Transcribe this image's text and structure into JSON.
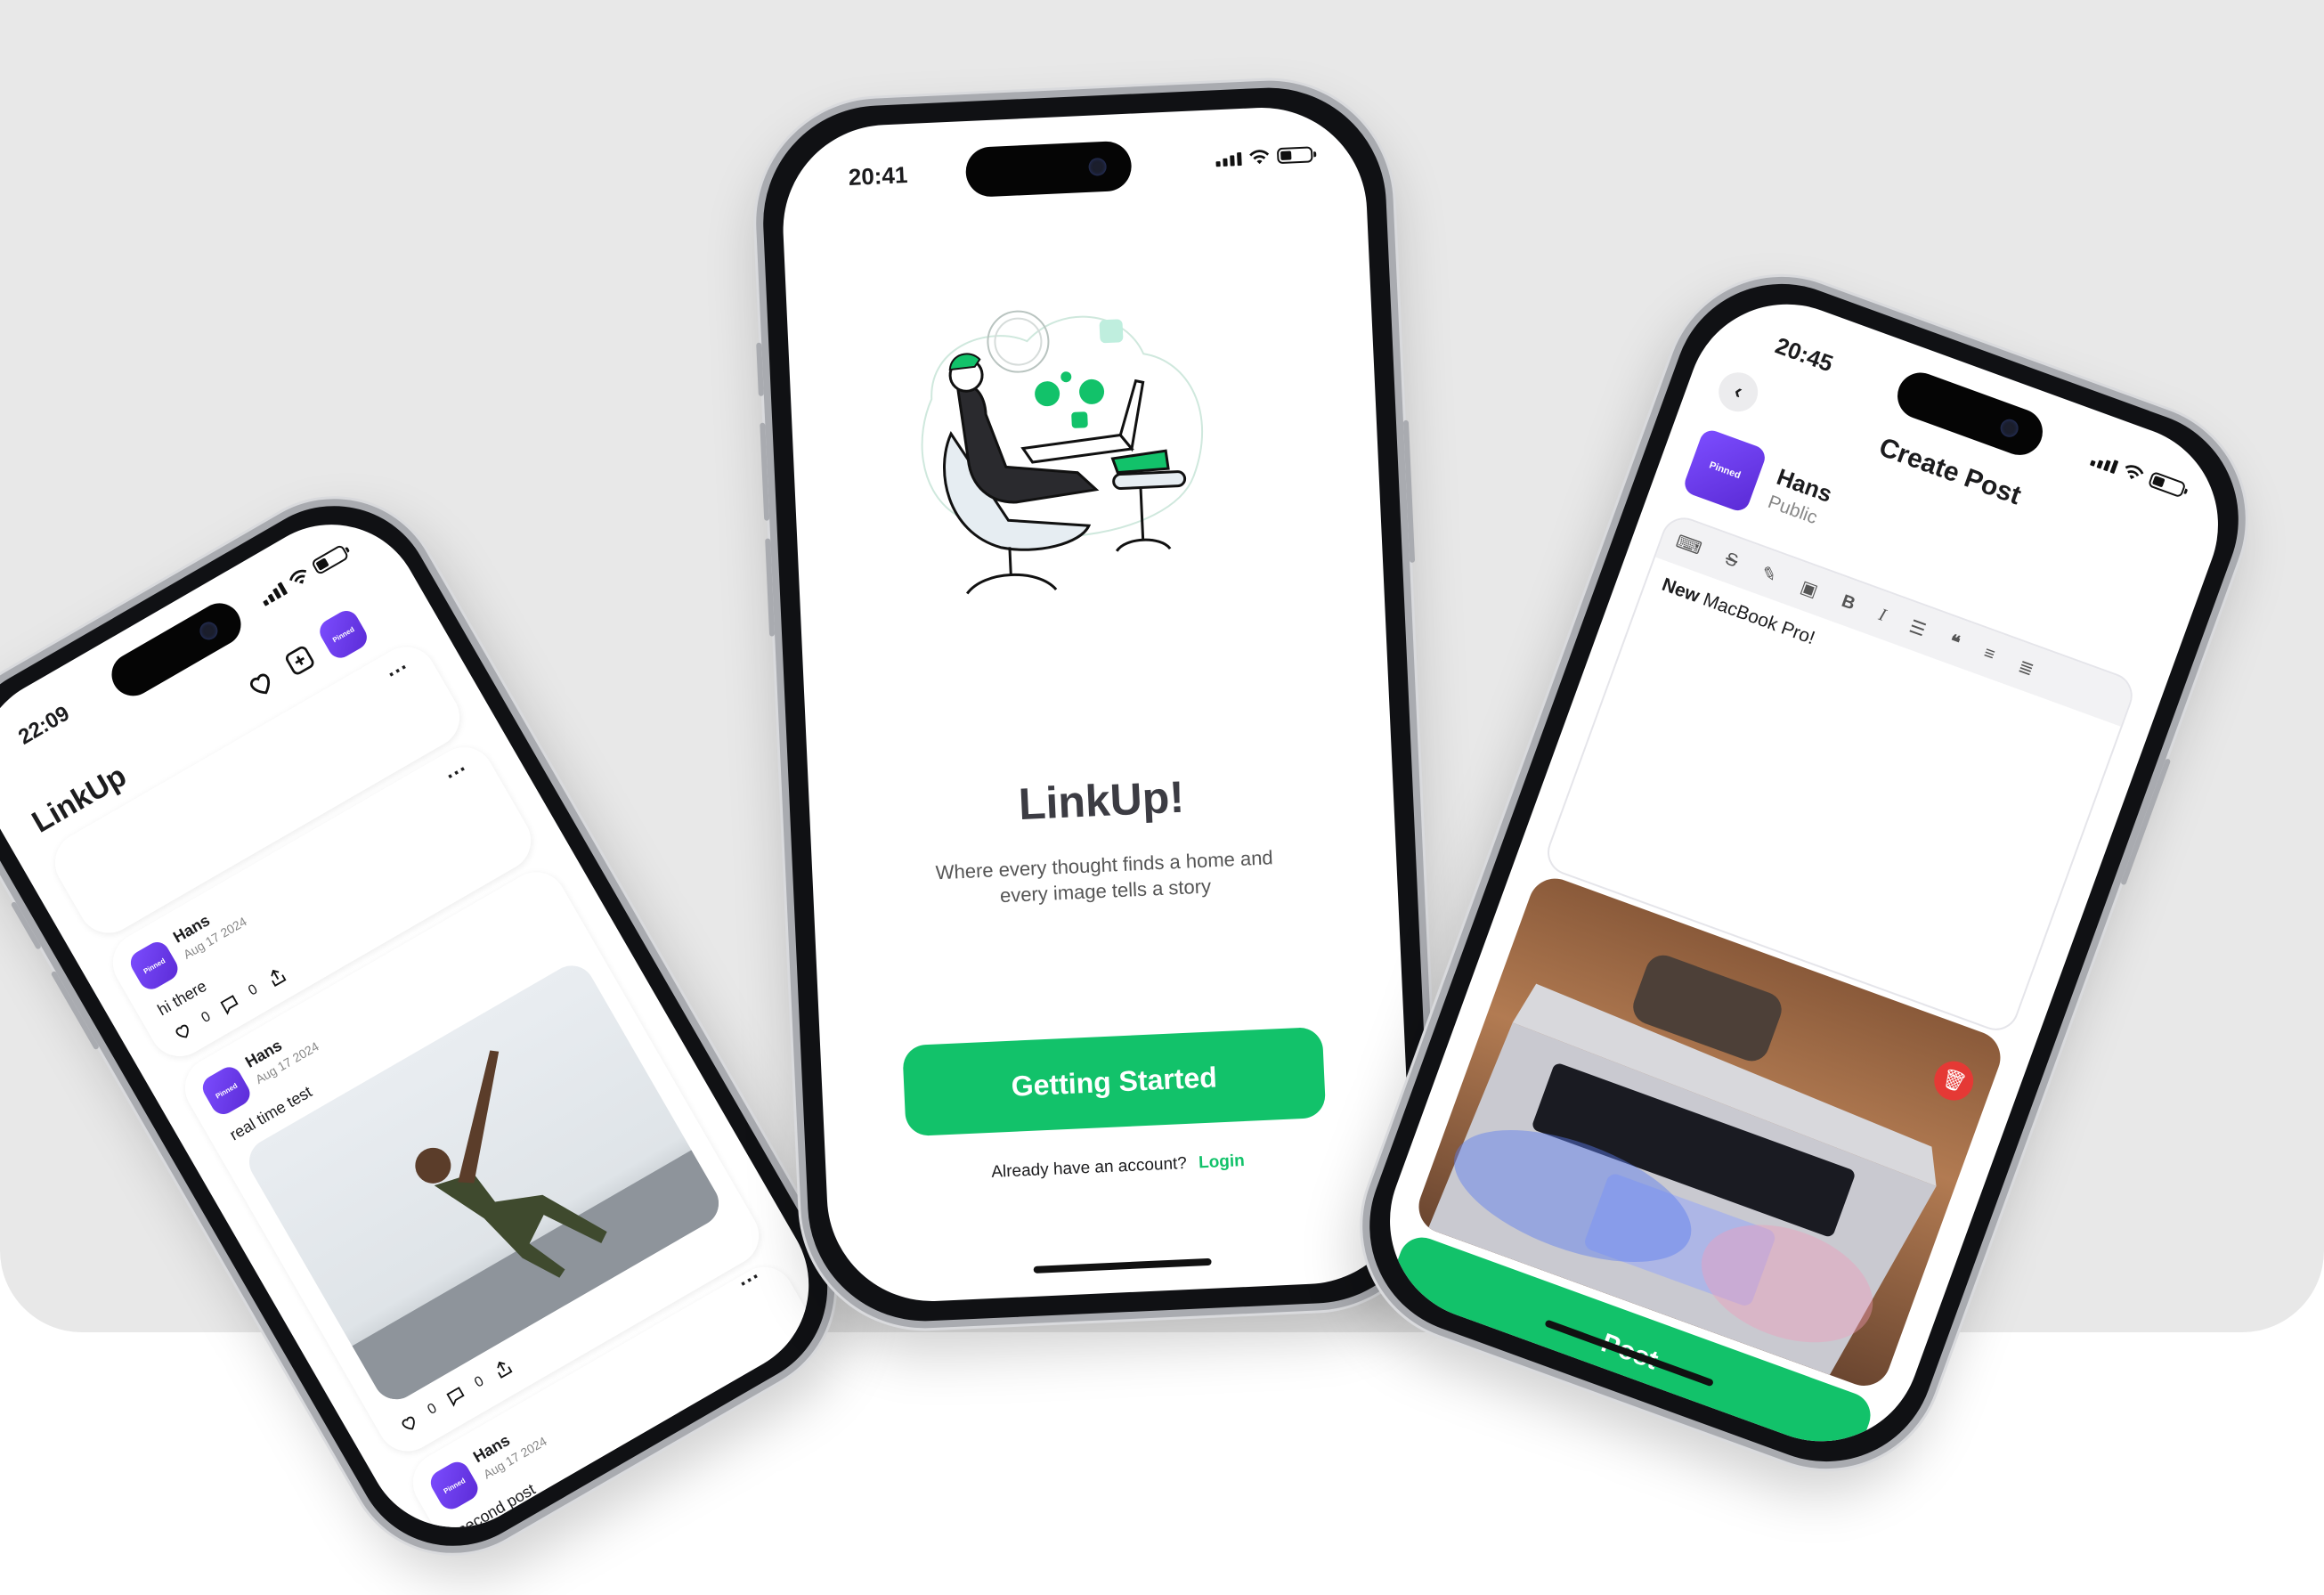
{
  "colors": {
    "background_panel": "#e8e8e8",
    "accent_green": "#12c26a",
    "avatar_purple": "#6a3cf0"
  },
  "left_phone": {
    "time": "22:09",
    "app_title": "LinkUp",
    "avatar_label": "Pinned",
    "posts": [
      {
        "author": "Hans",
        "date": "Aug 17 2024",
        "text": "hi there",
        "likes": "0",
        "comments": "0"
      },
      {
        "author": "Hans",
        "date": "Aug 17 2024",
        "text": "real time test",
        "likes": "0",
        "comments": "0"
      },
      {
        "author": "Hans",
        "date": "Aug 17 2024",
        "text": "second post"
      }
    ]
  },
  "center_phone": {
    "time": "20:41",
    "title": "LinkUp!",
    "subtitle_line1": "Where every thought finds a home and",
    "subtitle_line2": "every image tells a story",
    "cta_label": "Getting Started",
    "login_prompt": "Already have an account?",
    "login_link": "Login"
  },
  "right_phone": {
    "time": "20:45",
    "header_title": "Create Post",
    "user_name": "Hans",
    "visibility": "Public",
    "avatar_label": "Pinned",
    "editor_bold_word": "New",
    "editor_text": " MacBook Pro!",
    "toolbar_icons": [
      "keyboard-icon",
      "strikethrough-icon",
      "eraser-icon",
      "image-icon",
      "bold-icon",
      "italic-icon",
      "list-icon",
      "quote-icon",
      "align-left-icon",
      "align-center-icon"
    ],
    "post_button": "Post"
  }
}
